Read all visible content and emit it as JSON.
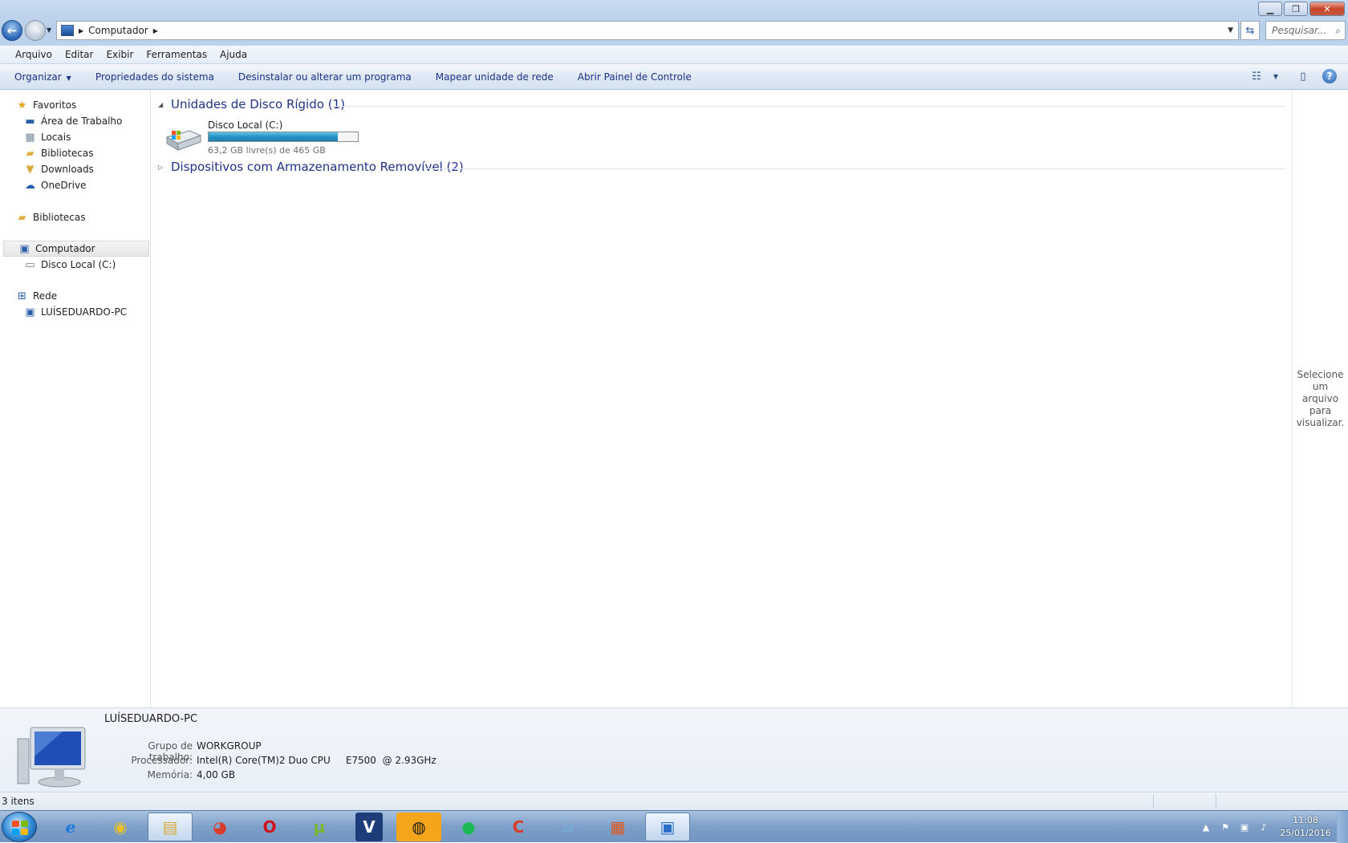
{
  "window": {
    "address": {
      "crumb": "Computador"
    },
    "search": {
      "placeholder": "Pesquisar..."
    }
  },
  "menubar": {
    "items": [
      "Arquivo",
      "Editar",
      "Exibir",
      "Ferramentas",
      "Ajuda"
    ]
  },
  "cmdbar": {
    "organize": "Organizar",
    "items": [
      "Propriedades do sistema",
      "Desinstalar ou alterar um programa",
      "Mapear unidade de rede",
      "Abrir Painel de Controle"
    ]
  },
  "nav": {
    "favorites": {
      "label": "Favoritos",
      "items": [
        "Área de Trabalho",
        "Locais",
        "Bibliotecas",
        "Downloads",
        "OneDrive"
      ]
    },
    "libraries": {
      "label": "Bibliotecas"
    },
    "computer": {
      "label": "Computador",
      "items": [
        "Disco Local (C:)"
      ]
    },
    "network": {
      "label": "Rede",
      "items": [
        "LUÍSEDUARDO-PC"
      ]
    }
  },
  "content": {
    "group_hdd": {
      "label": "Unidades de Disco Rígido (1)",
      "expanded": true
    },
    "drive": {
      "name": "Disco Local (C:)",
      "free_text": "63,2 GB livre(s) de 465 GB",
      "used_fraction": 0.864
    },
    "group_removable": {
      "label": "Dispositivos com Armazenamento Removível (2)",
      "expanded": false
    }
  },
  "preview": {
    "text": "Selecione um arquivo para visualizar."
  },
  "details": {
    "name": "LUÍSEDUARDO-PC",
    "workgroup_label": "Grupo de trabalho:",
    "workgroup": "WORKGROUP",
    "processor_label": "Processador:",
    "processor": "Intel(R) Core(TM)2 Duo CPU     E7500  @ 2.93GHz",
    "memory_label": "Memória:",
    "memory": "4,00 GB"
  },
  "statusbar": {
    "items_count": "3 itens"
  },
  "taskbar": {
    "apps": [
      "internet-explorer",
      "dvd-player",
      "file-explorer",
      "chrome",
      "opera",
      "utorrent",
      "vegas",
      "game-app",
      "spotify",
      "ccleaner",
      "notepad",
      "avg",
      "control-panel"
    ],
    "clock_time": "11:08",
    "clock_date": "25/01/2016"
  }
}
